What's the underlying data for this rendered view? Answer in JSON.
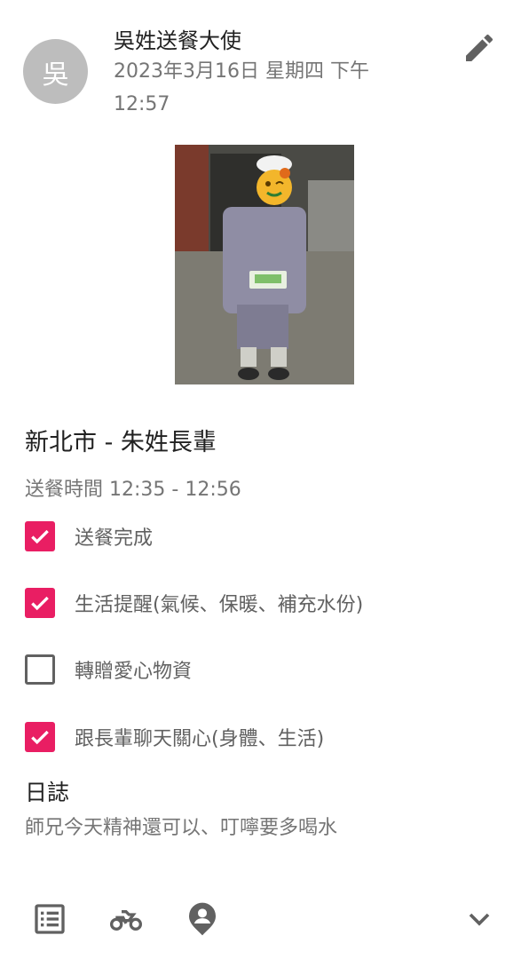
{
  "author": {
    "avatar_initial": "吳",
    "name": "吳姓送餐大使",
    "timestamp": "2023年3月16日 星期四 下午 12:57"
  },
  "post": {
    "location_title": "新北市 - 朱姓長輩",
    "delivery_time": "送餐時間 12:35 - 12:56",
    "checklist": [
      {
        "label": "送餐完成",
        "checked": true
      },
      {
        "label": "生活提醒(氣候、保暖、補充水份)",
        "checked": true
      },
      {
        "label": "轉贈愛心物資",
        "checked": false
      },
      {
        "label": "跟長輩聊天關心(身體、生活)",
        "checked": true
      }
    ],
    "journal_heading": "日誌",
    "journal_text": "師兄今天精神還可以、叮嚀要多喝水"
  },
  "icons": {
    "edit": "pencil-icon",
    "list": "list-icon",
    "motorcycle": "motorcycle-icon",
    "location_person": "person-pin-icon",
    "expand": "chevron-down-icon"
  },
  "colors": {
    "accent": "#e91e63",
    "icon_gray": "#616161",
    "secondary_text": "#757575",
    "avatar_bg": "#bdbdbd"
  }
}
